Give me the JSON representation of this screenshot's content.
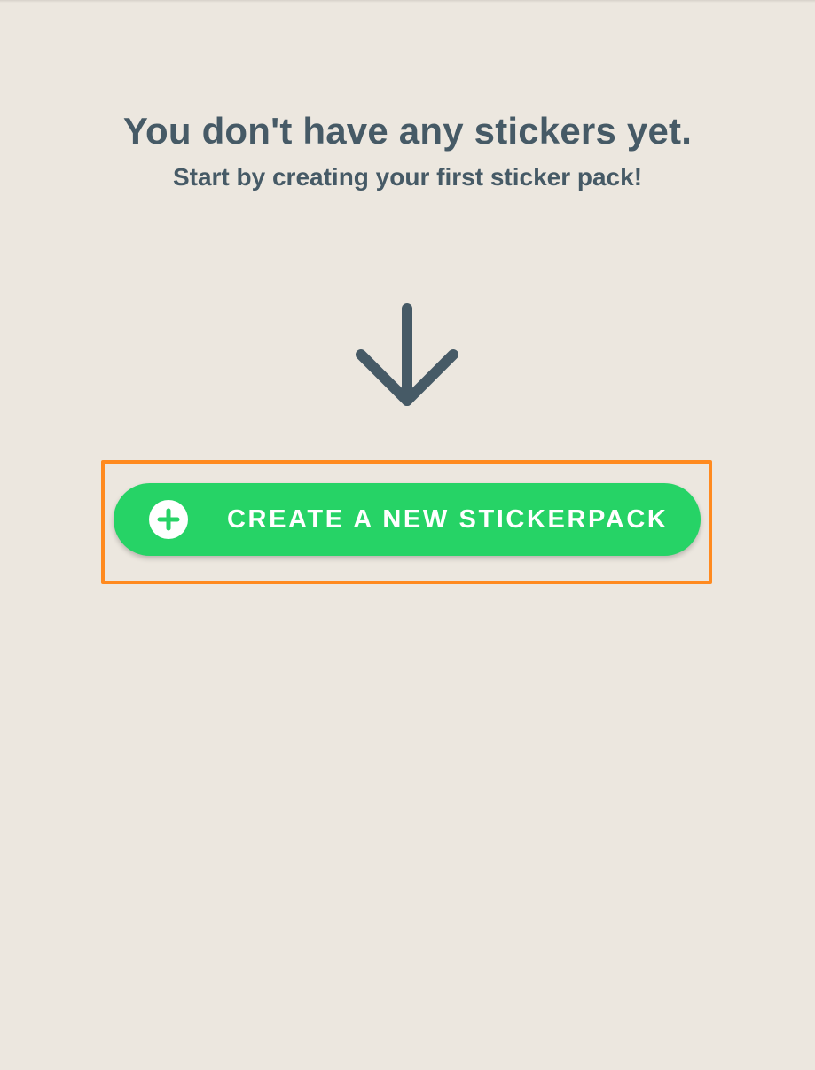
{
  "empty_state": {
    "title": "You don't have any stickers yet.",
    "subtitle": "Start by creating your first sticker pack!",
    "arrow_icon": "arrow-down-icon"
  },
  "create_button": {
    "label": "CREATE A NEW STICKERPACK",
    "icon": "plus-circle-icon"
  },
  "colors": {
    "background": "#ece7df",
    "text": "#465a66",
    "button": "#26d366",
    "highlight": "#ff8a1f"
  }
}
